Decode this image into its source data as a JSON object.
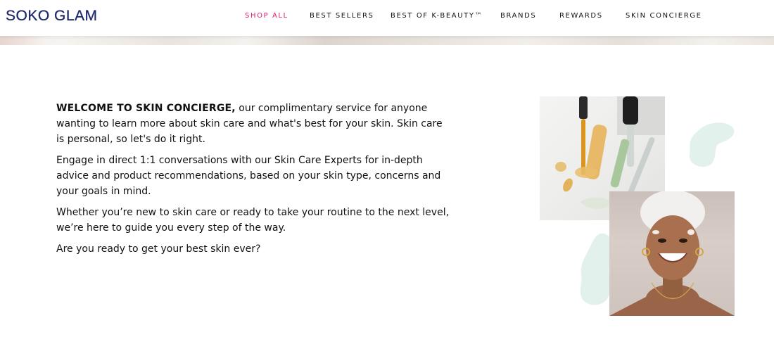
{
  "header": {
    "logo": "SOKO GLAM",
    "nav": [
      {
        "label": "SHOP ALL",
        "active": true
      },
      {
        "label": "BEST SELLERS",
        "active": false
      },
      {
        "label": "BEST OF K-BEAUTY™",
        "active": false
      },
      {
        "label": "BRANDS",
        "active": false
      },
      {
        "label": "REWARDS",
        "active": false
      },
      {
        "label": "SKIN CONCIERGE",
        "active": false
      }
    ]
  },
  "content": {
    "lead": "WELCOME TO SKIN CONCIERGE,",
    "intro": " our complimentary service for anyone wanting to learn more about skin care and what's best for your skin. Skin care is personal, so let's do it right.",
    "paragraph2": "Engage in direct 1:1 conversations with our Skin Care Experts for in-depth advice and product recommendations, based on your skin type, concerns and your goals in mind.",
    "paragraph3": "Whether you’re new to skin care or ready to take your routine to the next level, we’re here to guide you every step of the way.",
    "paragraph4": "Are you ready to get your best skin ever?"
  },
  "colors": {
    "logo": "#1d2a6b",
    "nav_active": "#e01e73",
    "blob_mint": "#e3f1ec"
  },
  "images": {
    "serum_photo": "serum-dropper-image",
    "portrait_photo": "smiling-woman-portrait-image"
  }
}
